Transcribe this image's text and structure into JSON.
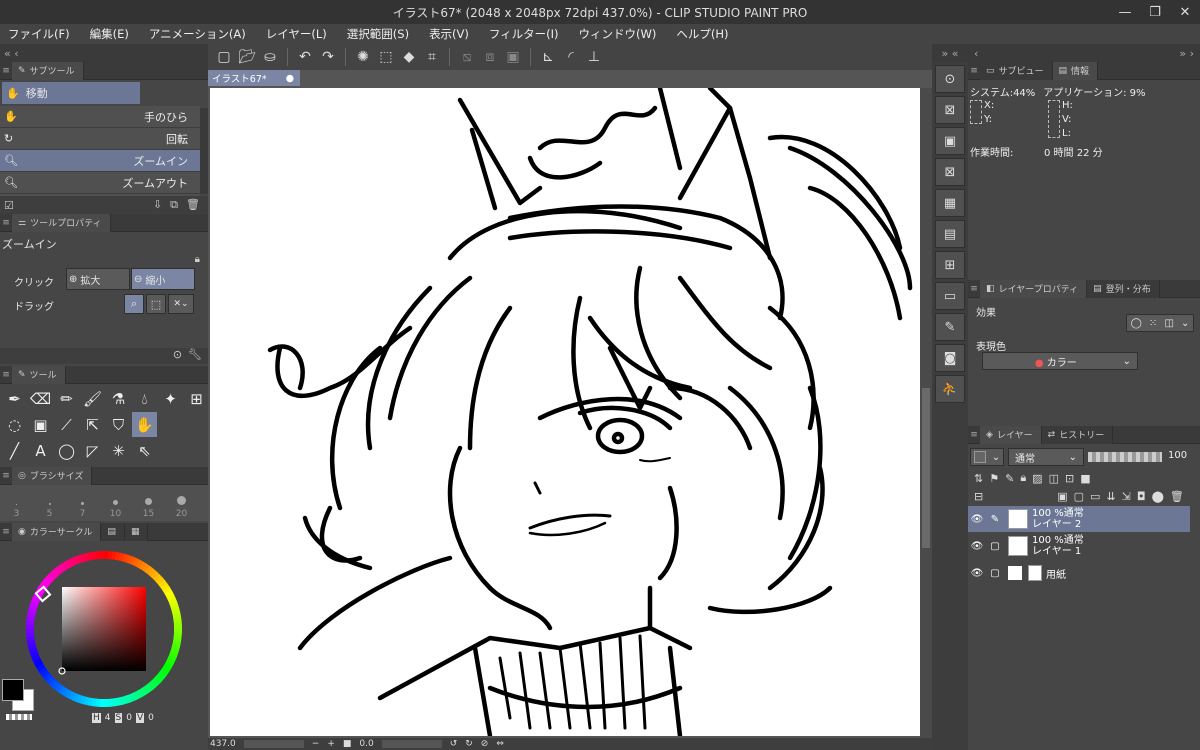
{
  "window": {
    "title": "イラスト67* (2048 x 2048px 72dpi 437.0%)  - CLIP STUDIO PAINT PRO",
    "controls": [
      "—",
      "❐",
      "✕"
    ]
  },
  "menu": [
    "ファイル(F)",
    "編集(E)",
    "アニメーション(A)",
    "レイヤー(L)",
    "選択範囲(S)",
    "表示(V)",
    "フィルター(I)",
    "ウィンドウ(W)",
    "ヘルプ(H)"
  ],
  "subtool": {
    "tab": "サブツール",
    "group": "移動",
    "items": [
      {
        "label": "手のひら",
        "icon": "hand-icon",
        "selected": false
      },
      {
        "label": "回転",
        "icon": "rotate-icon",
        "selected": false
      },
      {
        "label": "ズームイン",
        "icon": "zoom-in-icon",
        "selected": true
      },
      {
        "label": "ズームアウト",
        "icon": "zoom-out-icon",
        "selected": false
      }
    ]
  },
  "tool_property": {
    "tab": "ツールプロパティ",
    "title": "ズームイン",
    "click_label": "クリック",
    "enlarge": "拡大",
    "shrink": "縮小",
    "drag_label": "ドラッグ"
  },
  "tools": {
    "tab": "ツール"
  },
  "brush_size": {
    "tab": "ブラシサイズ",
    "sizes": [
      "3",
      "5",
      "7",
      "10",
      "15",
      "20"
    ]
  },
  "color_circle": {
    "tab": "カラーサークル",
    "h_label": "H",
    "h": "4",
    "s_label": "S",
    "s": "0",
    "v_label": "V",
    "v": "0",
    "main_color": "#000000",
    "sub_color": "#ffffff"
  },
  "canvas": {
    "tab": "イラスト67*",
    "zoom": "437.0",
    "angle": "0.0"
  },
  "info": {
    "tab_sub": "サブビュー",
    "tab": "情報",
    "system_label": "システム:44%",
    "app_label": "アプリケーション: 9%",
    "x": "X:",
    "y": "Y:",
    "h": "H:",
    "v": "V:",
    "l": "L:",
    "work_time_label": "作業時間:",
    "work_time": "0 時間 22 分"
  },
  "layer_property": {
    "tab": "レイヤープロパティ",
    "tab2": "登列・分布",
    "effect_label": "効果",
    "color_label": "表現色",
    "color_value": "カラー"
  },
  "layers": {
    "tab": "レイヤー",
    "tab2": "ヒストリー",
    "blend": "通常",
    "opacity": "100",
    "items": [
      {
        "line1": "100 %通常",
        "line2": "レイヤー 2",
        "selected": true
      },
      {
        "line1": "100 %通常",
        "line2": "レイヤー 1",
        "selected": false
      },
      {
        "line1": "",
        "line2": "用紙",
        "selected": false
      }
    ]
  }
}
